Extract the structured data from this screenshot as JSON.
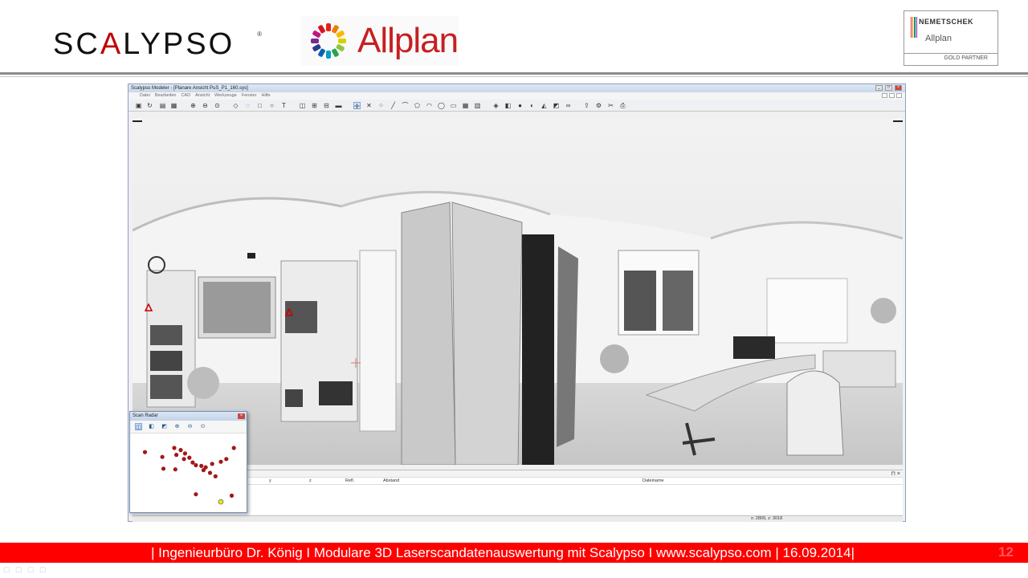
{
  "header": {
    "scalypso_logo": "SCALYPSO",
    "allplan_logo": "Allplan",
    "partner_brand": "NEMETSCHEK",
    "partner_sub": "Allplan",
    "partner_level": "GOLD PARTNER"
  },
  "app": {
    "title": "Scalypso Modeler - [Planare Ansicht PuS_P1_160.sys]",
    "menu": [
      "Datei",
      "Bearbeiten",
      "CAD",
      "Ansicht",
      "Werkzeuge",
      "Fenster",
      "Hilfe"
    ],
    "table_columns": [
      "x",
      "y",
      "z",
      "Refl.",
      "Abstand",
      "Dateiname"
    ],
    "status_coords": "x: 2809, z: 3018"
  },
  "radar": {
    "title": "Scan Radar",
    "points": [
      [
        0.1,
        0.2
      ],
      [
        0.37,
        0.14
      ],
      [
        0.43,
        0.17
      ],
      [
        0.39,
        0.24
      ],
      [
        0.47,
        0.22
      ],
      [
        0.26,
        0.27
      ],
      [
        0.46,
        0.3
      ],
      [
        0.51,
        0.28
      ],
      [
        0.54,
        0.35
      ],
      [
        0.57,
        0.39
      ],
      [
        0.62,
        0.4
      ],
      [
        0.66,
        0.42
      ],
      [
        0.72,
        0.37
      ],
      [
        0.8,
        0.34
      ],
      [
        0.85,
        0.3
      ],
      [
        0.92,
        0.14
      ],
      [
        0.64,
        0.46
      ],
      [
        0.7,
        0.5
      ],
      [
        0.75,
        0.55
      ],
      [
        0.27,
        0.44
      ],
      [
        0.38,
        0.45
      ],
      [
        0.57,
        0.81
      ],
      [
        0.9,
        0.83
      ]
    ],
    "highlight_point": [
      0.8,
      0.92
    ],
    "point_color": "#a01818",
    "highlight_color": "#e8e81a"
  },
  "footer": {
    "text": "| Ingenieurbüro Dr. König  I Modulare 3D Laserscandatenauswertung mit Scalypso  I www.scalypso.com | 16.09.2014|",
    "page_number": "12",
    "bar_color": "#ff0000"
  }
}
